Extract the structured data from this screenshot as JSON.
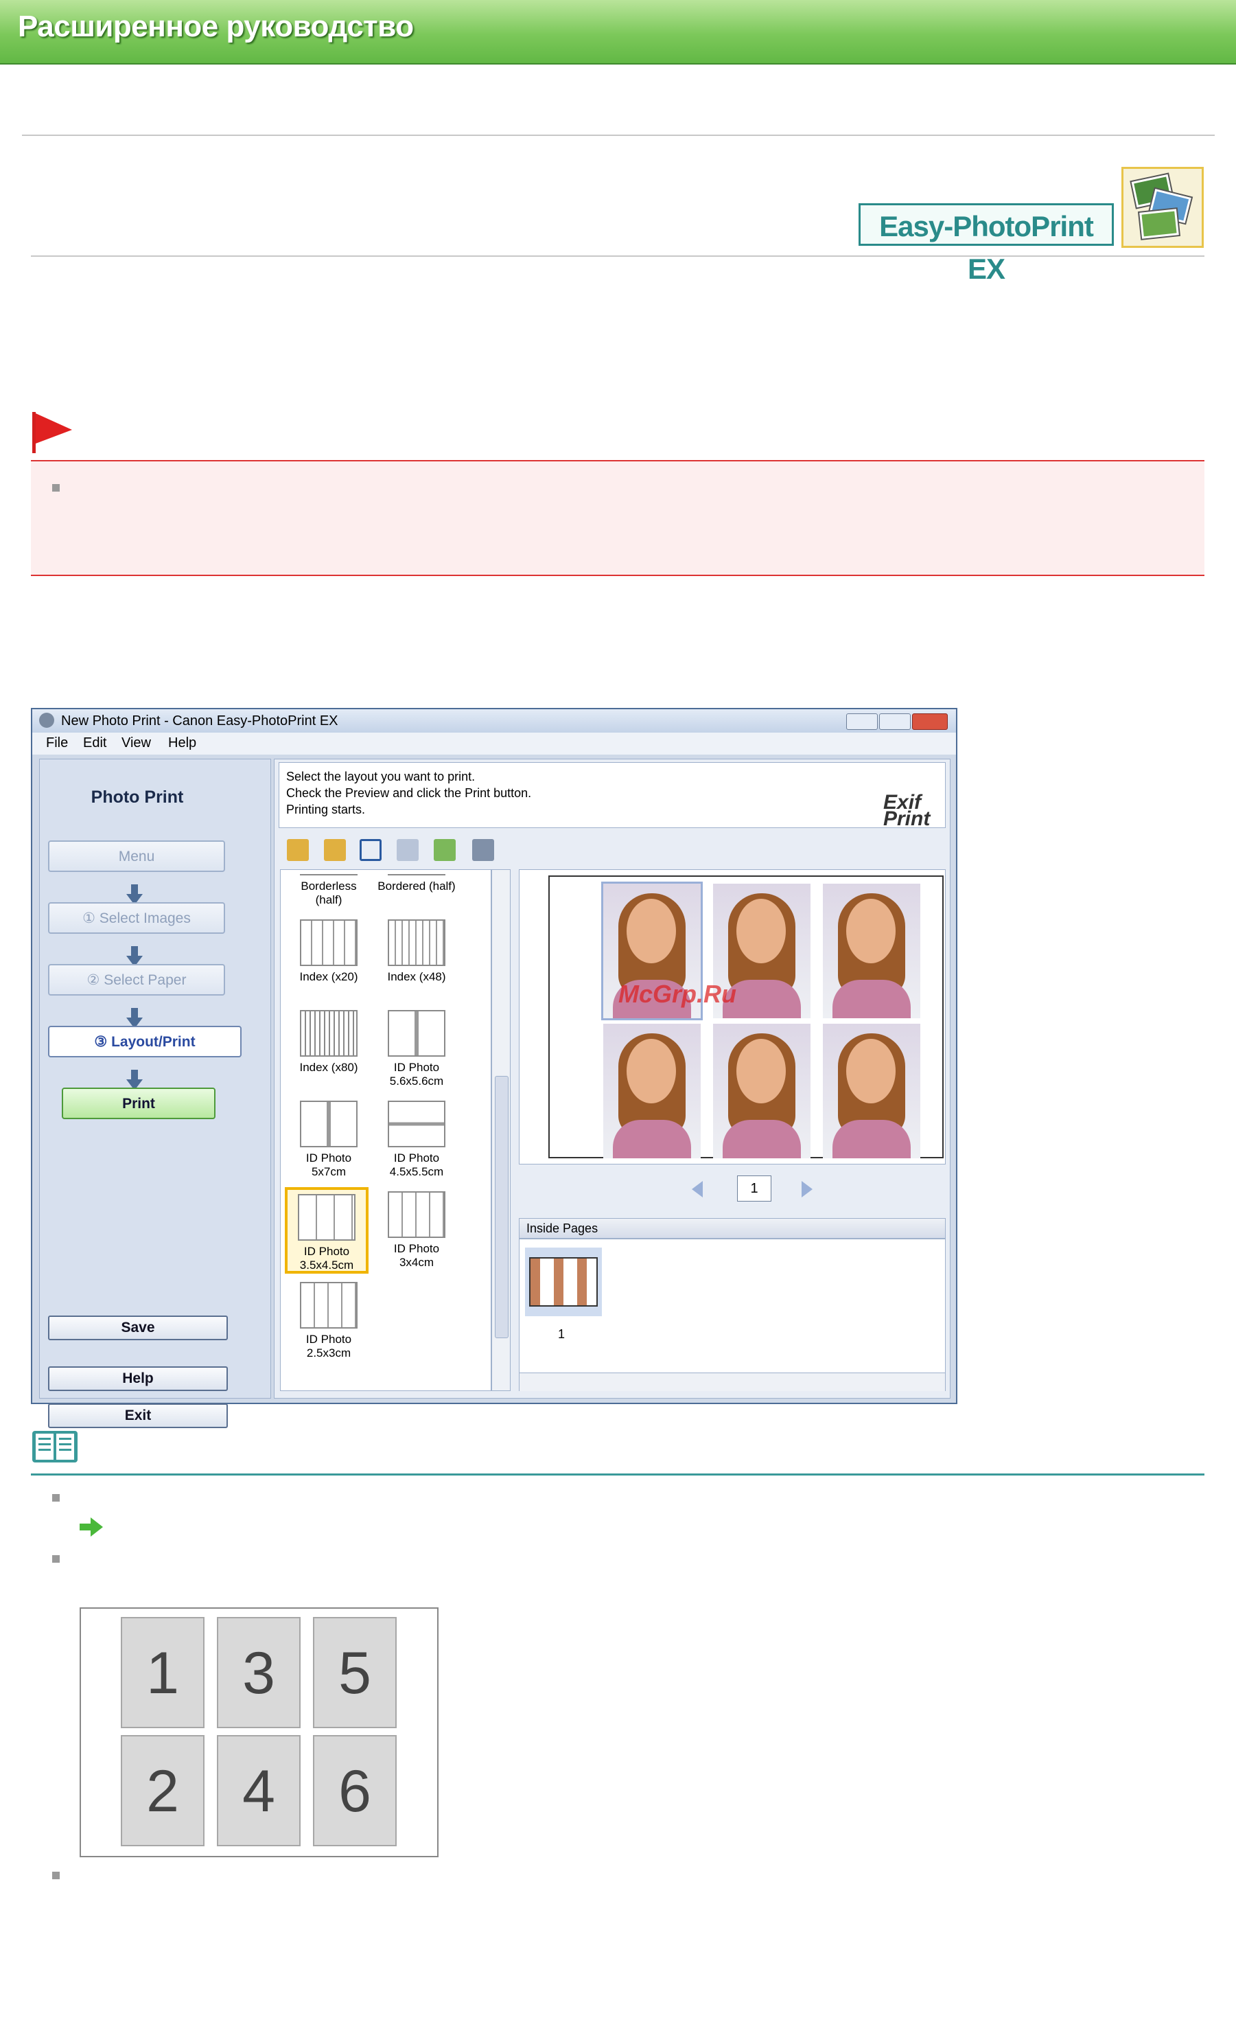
{
  "banner": {
    "title": "Расширенное руководство"
  },
  "logo": {
    "text": "Easy-PhotoPrint EX"
  },
  "window": {
    "title": "New Photo Print - Canon Easy-PhotoPrint EX",
    "menu": [
      "File",
      "Edit",
      "View",
      "Help"
    ],
    "sidebar": {
      "title": "Photo Print",
      "steps": [
        "Menu",
        "① Select Images",
        "② Select Paper",
        "③ Layout/Print"
      ],
      "print_label": "Print",
      "save_label": "Save",
      "help_label": "Help",
      "exit_label": "Exit"
    },
    "instructions": [
      "Select the layout you want to print.",
      "Check the Preview and click the Print button.",
      "Printing starts."
    ],
    "exif_logo": "Exif Print",
    "layouts": [
      "Borderless (half)",
      "Bordered (half)",
      "Index (x20)",
      "Index (x48)",
      "Index (x80)",
      "ID Photo 5.6x5.6cm",
      "ID Photo 5x7cm",
      "ID Photo 4.5x5.5cm",
      "ID Photo 3.5x4.5cm",
      "ID Photo 3x4cm",
      "ID Photo 2.5x3cm"
    ],
    "selected_layout": "ID Photo 3.5x4.5cm",
    "watermark": "McGrp.Ru",
    "page_number": "1",
    "inside_pages_label": "Inside Pages",
    "thumbnail_label": "1"
  },
  "order_diagram": [
    "1",
    "3",
    "5",
    "2",
    "4",
    "6"
  ],
  "colors": {
    "accent_green": "#62b845",
    "caution_red": "#dd2222",
    "note_teal": "#3a9a9a",
    "selection": "#f0b400"
  }
}
